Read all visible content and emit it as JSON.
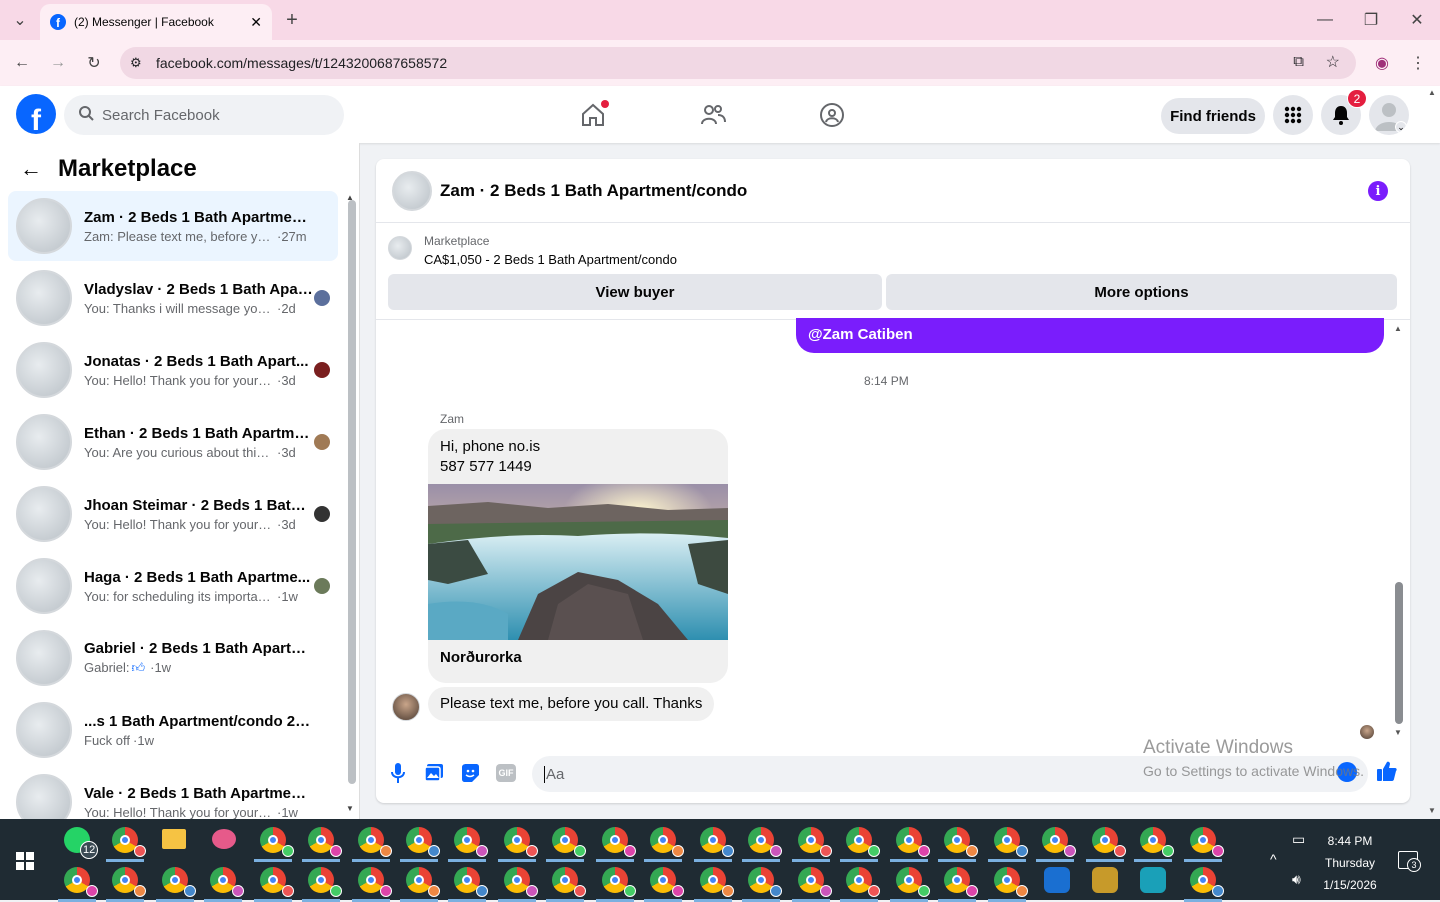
{
  "browser": {
    "tab_title": "(2) Messenger | Facebook",
    "url": "facebook.com/messages/t/1243200687658572"
  },
  "header": {
    "search_placeholder": "Search Facebook",
    "find_friends": "Find friends",
    "notification_count": "2"
  },
  "sidebar": {
    "title": "Marketplace",
    "conversations": [
      {
        "name": "Zam · 2 Beds 1 Bath Apartment/...",
        "preview": "Zam: Please text me, before you ...",
        "time": "·27m",
        "active": true
      },
      {
        "name": "Vladyslav · 2 Beds 1 Bath Apar...",
        "preview": "You: Thanks i will message you i...",
        "time": "·2d",
        "seen_color": "#5b6f9c"
      },
      {
        "name": "Jonatas · 2 Beds 1 Bath Apart...",
        "preview": "You: Hello! Thank you for your in...",
        "time": "·3d",
        "seen_color": "#7a1f1f"
      },
      {
        "name": "Ethan · 2 Beds 1 Bath Apartme...",
        "preview": "You: Are you curious about this ...",
        "time": "·3d",
        "seen_color": "#a07a55"
      },
      {
        "name": "Jhoan Steimar · 2 Beds 1 Bath ...",
        "preview": "You: Hello! Thank you for your in...",
        "time": "·3d",
        "seen_color": "#333333"
      },
      {
        "name": "Haga · 2 Beds 1 Bath Apartme...",
        "preview": "You: for scheduling its important...",
        "time": "·1w",
        "seen_color": "#6b7a5a"
      },
      {
        "name": "Gabriel · 2 Beds 1 Bath Apartme...",
        "preview": "Gabriel:",
        "time": "·1w"
      },
      {
        "name": "...s 1 Bath Apartment/condo 2 · جا",
        "preview": "Fuck off",
        "time": "·1w"
      },
      {
        "name": "Vale · 2 Beds 1 Bath Apartment/...",
        "preview": "You: Hello! Thank you for your inte...",
        "time": "·1w"
      }
    ]
  },
  "chat": {
    "title": "Zam · 2 Beds 1 Bath Apartment/condo",
    "listing_label": "Marketplace",
    "listing_title": "CA$1,050 - 2 Beds 1 Bath Apartment/condo",
    "view_buyer": "View buyer",
    "more_options": "More options",
    "my_message_tail": "@Zam Catiben",
    "timestamp": "8:14 PM",
    "sender": "Zam",
    "message1_line1": "Hi, phone no.is",
    "message1_line2": "587 577 1449",
    "image_caption": "Norðurorka",
    "message2": "Please text me, before you call. Thanks",
    "input_placeholder": "Aa"
  },
  "watermark": {
    "line1": "Activate Windows",
    "line2": "Go to Settings to activate Windows."
  },
  "taskbar": {
    "whatsapp_badge": "12",
    "time": "8:44 PM",
    "day": "Thursday",
    "date": "1/15/2026",
    "notif_count": "3"
  },
  "colors": {
    "facebook_blue": "#0866ff",
    "messenger_purple": "#7a1dfc",
    "notification_red": "#e41e3f"
  }
}
